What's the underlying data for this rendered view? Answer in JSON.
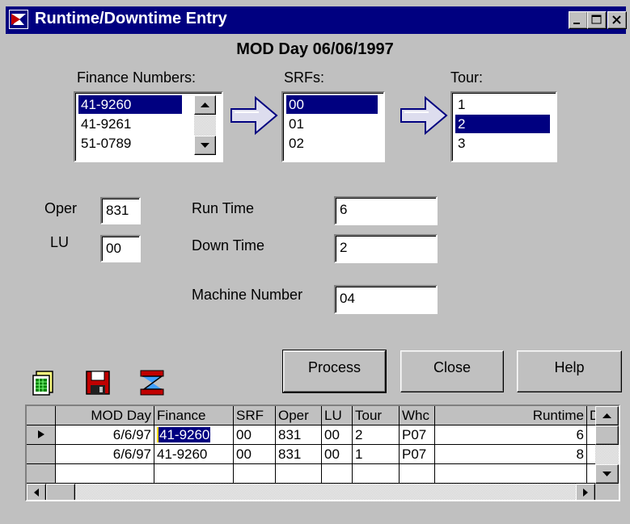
{
  "window": {
    "title": "Runtime/Downtime Entry"
  },
  "heading": "MOD Day 06/06/1997",
  "finance": {
    "label": "Finance Numbers:",
    "items": [
      "41-9260",
      "41-9261",
      "51-0789"
    ],
    "selected": "41-9260"
  },
  "srfs": {
    "label": "SRFs:",
    "items": [
      "00",
      "01",
      "02"
    ],
    "selected": "00"
  },
  "tour": {
    "label": "Tour:",
    "items": [
      "1",
      "2",
      "3"
    ],
    "selected": "2"
  },
  "fields": {
    "oper": {
      "label": "Oper",
      "value": "831"
    },
    "lu": {
      "label": "LU",
      "value": "00"
    },
    "run_time": {
      "label": "Run Time",
      "value": "6"
    },
    "down_time": {
      "label": "Down Time",
      "value": "2"
    },
    "machine_number": {
      "label": "Machine Number",
      "value": "04"
    }
  },
  "buttons": {
    "process": "Process",
    "close": "Close",
    "help": "Help"
  },
  "toolbar_icons": [
    "spreadsheet-icon",
    "save-icon",
    "clear-icon"
  ],
  "grid": {
    "columns": [
      "MOD Day",
      "Finance",
      "SRF",
      "Oper",
      "LU",
      "Tour",
      "Whc",
      "Runtime",
      "D"
    ],
    "rows": [
      [
        "6/6/97",
        "41-9260",
        "00",
        "831",
        "00",
        "2",
        "P07",
        "6"
      ],
      [
        "6/6/97",
        "41-9260",
        "00",
        "831",
        "00",
        "1",
        "P07",
        "8"
      ]
    ],
    "current_row": 0
  },
  "colors": {
    "titlebar": "#000080",
    "face": "#c0c0c0",
    "selection": "#000080"
  }
}
